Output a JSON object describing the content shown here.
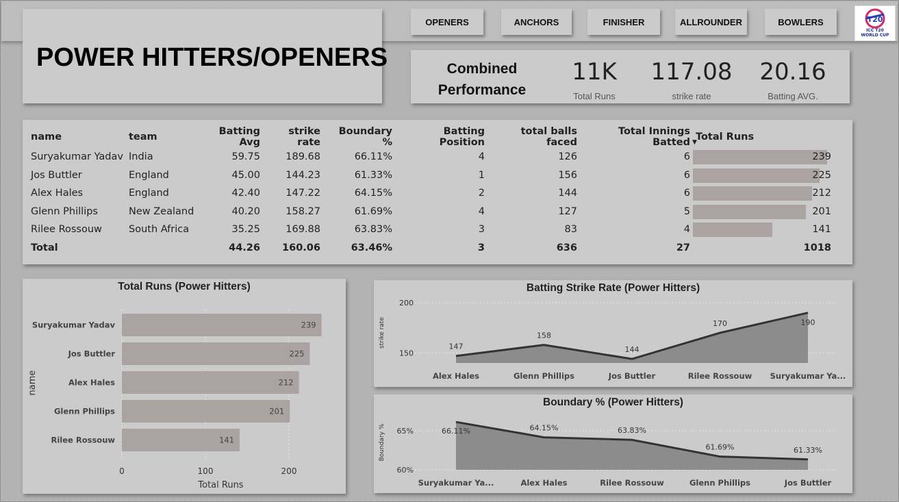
{
  "page_title": "POWER HITTERS/OPENERS",
  "nav": [
    {
      "label": "OPENERS",
      "name": "nav-button-openers"
    },
    {
      "label": "ANCHORS",
      "name": "nav-button-anchors"
    },
    {
      "label": "FINISHER",
      "name": "nav-button-finisher"
    },
    {
      "label": "ALLROUNDER",
      "name": "nav-button-allrounder"
    },
    {
      "label": "BOWLERS",
      "name": "nav-button-bowlers"
    }
  ],
  "logo_text": "ICC T20 WORLD CUP",
  "kpis": {
    "heading": "Combined Performance",
    "total_runs": {
      "value": "11K",
      "label": "Total Runs"
    },
    "strike_rate": {
      "value": "117.08",
      "label": "strike rate"
    },
    "batting_avg": {
      "value": "20.16",
      "label": "Batting AVG."
    }
  },
  "table": {
    "columns": [
      "name",
      "team",
      "Batting Avg",
      "strike rate",
      "Boundary %",
      "Batting Position",
      "total balls faced",
      "Total Innings Batted",
      "Total Runs"
    ],
    "rows": [
      [
        "Suryakumar Yadav",
        "India",
        "59.75",
        "189.68",
        "66.11%",
        "4",
        "126",
        "6",
        "239"
      ],
      [
        "Jos Buttler",
        "England",
        "45.00",
        "144.23",
        "61.33%",
        "1",
        "156",
        "6",
        "225"
      ],
      [
        "Alex Hales",
        "England",
        "42.40",
        "147.22",
        "64.15%",
        "2",
        "144",
        "6",
        "212"
      ],
      [
        "Glenn Phillips",
        "New Zealand",
        "40.20",
        "158.27",
        "61.69%",
        "4",
        "127",
        "5",
        "201"
      ],
      [
        "Rilee Rossouw",
        "South Africa",
        "35.25",
        "169.88",
        "63.83%",
        "3",
        "83",
        "4",
        "141"
      ]
    ],
    "total": [
      "Total",
      "",
      "44.26",
      "160.06",
      "63.46%",
      "3",
      "636",
      "27",
      "1018"
    ],
    "run_values": [
      239,
      225,
      212,
      201,
      141
    ],
    "bar_color": "#aaa3a2"
  },
  "chart_data": [
    {
      "type": "bar",
      "title": "Total Runs (Power Hitters)",
      "xlabel": "Total Runs",
      "ylabel": "name",
      "categories": [
        "Suryakumar Yadav",
        "Jos Buttler",
        "Alex Hales",
        "Glenn Phillips",
        "Rilee Rossouw"
      ],
      "values": [
        239,
        225,
        212,
        201,
        141
      ],
      "xlim": [
        0,
        250
      ],
      "xticks": [
        "0",
        "100",
        "200"
      ],
      "grid": true,
      "color": "#aaa3a2"
    },
    {
      "type": "area",
      "title": "Batting Strike Rate (Power Hitters)",
      "ylabel": "strike rate",
      "categories": [
        "Alex Hales",
        "Glenn Phillips",
        "Jos Buttler",
        "Rilee Rossouw",
        "Suryakumar Ya..."
      ],
      "values": [
        147,
        158,
        144,
        170,
        190
      ],
      "value_labels": [
        "147",
        "158",
        "144",
        "170",
        "190"
      ],
      "ylim": [
        140,
        200
      ],
      "yticks": [
        "150",
        "200"
      ],
      "grid": true,
      "color": "#8c8c8c"
    },
    {
      "type": "area",
      "title": "Boundary % (Power Hitters)",
      "ylabel": "Boundary %",
      "categories": [
        "Suryakumar Ya...",
        "Alex Hales",
        "Rilee Rossouw",
        "Glenn Phillips",
        "Jos Buttler"
      ],
      "values": [
        66.11,
        64.15,
        63.83,
        61.69,
        61.33
      ],
      "value_labels": [
        "66.11%",
        "64.15%",
        "63.83%",
        "61.69%",
        "61.33%"
      ],
      "ylim": [
        60,
        67
      ],
      "yticks": [
        "60%",
        "65%"
      ],
      "grid": true,
      "color": "#8c8c8c"
    }
  ]
}
